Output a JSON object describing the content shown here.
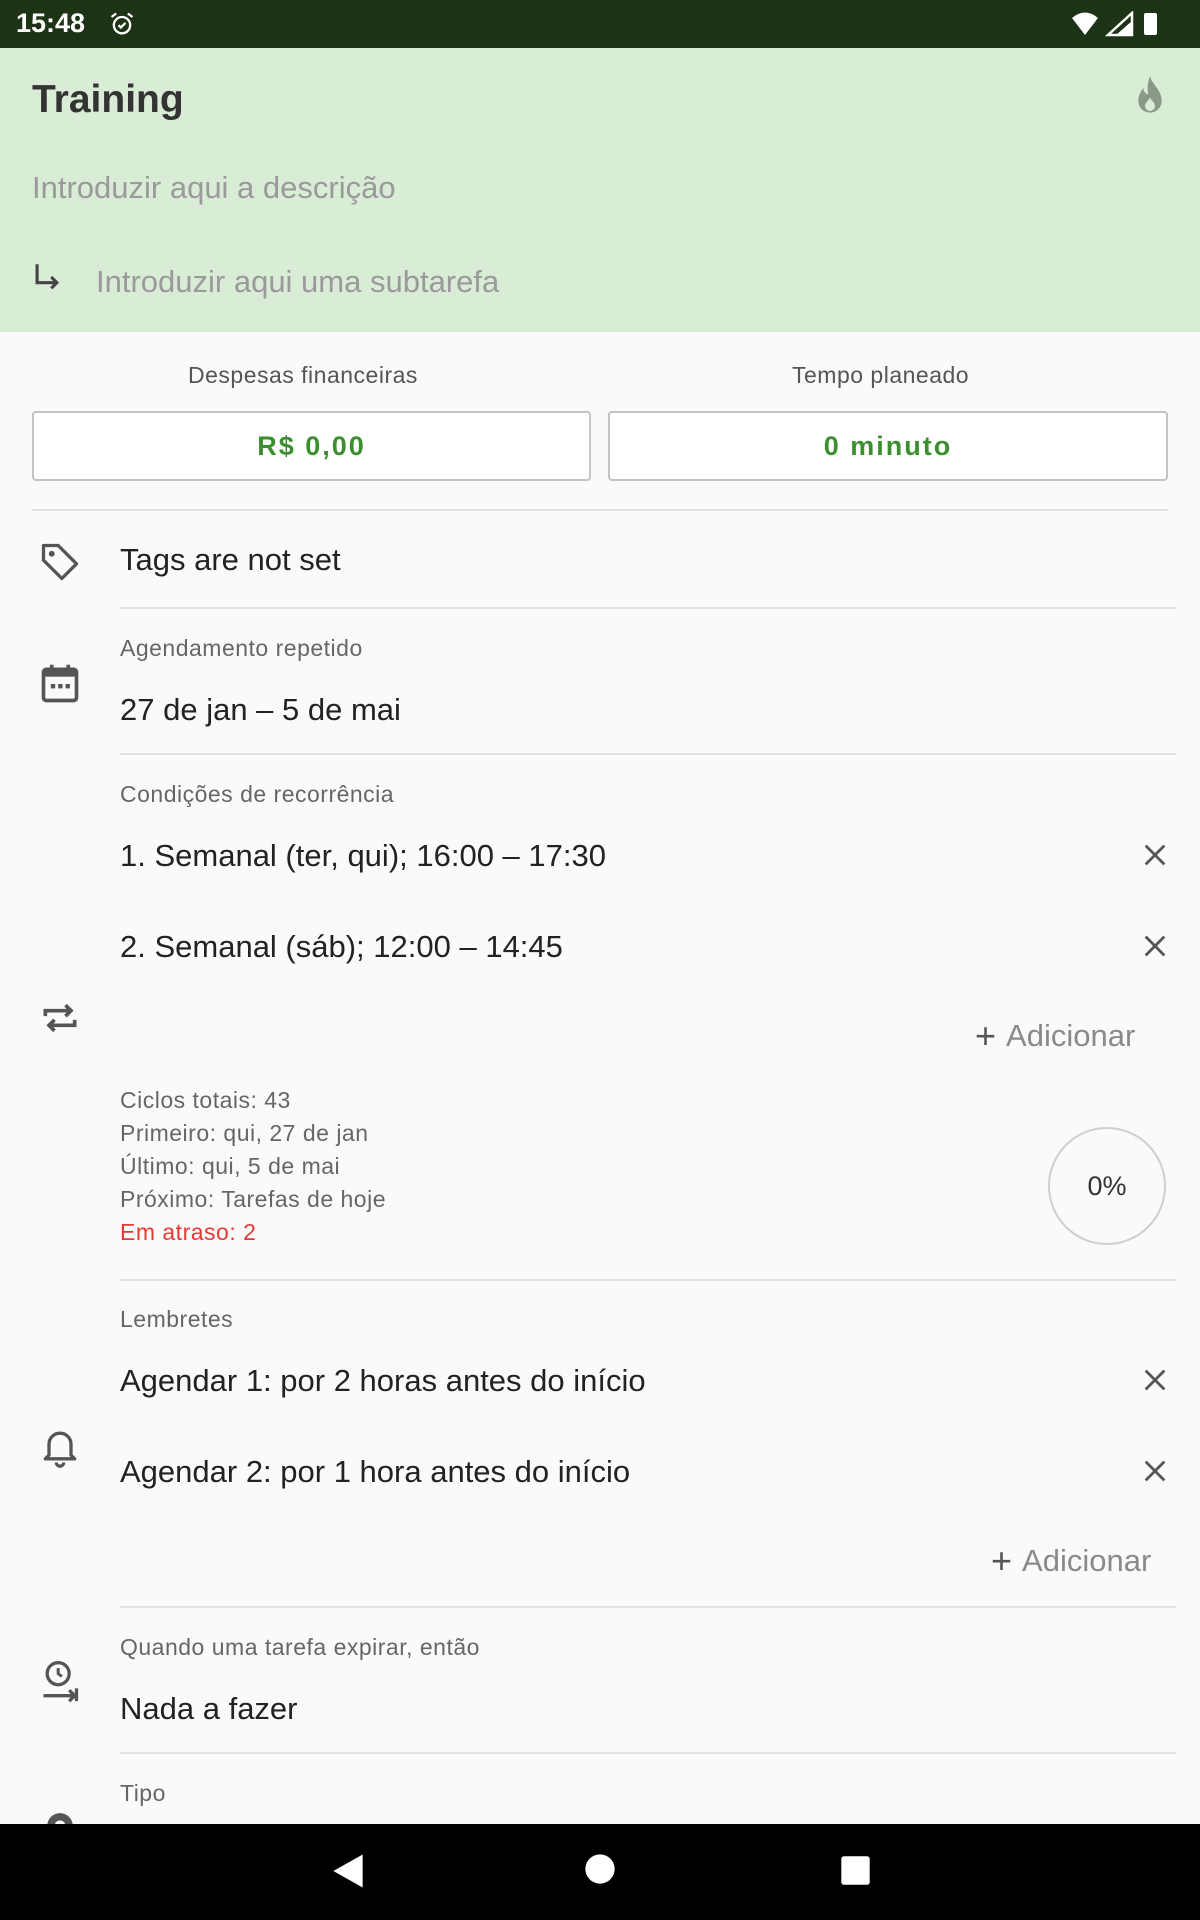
{
  "status_bar": {
    "time": "15:48"
  },
  "task": {
    "title": "Training",
    "description_placeholder": "Introduzir aqui a descrição",
    "subtask_placeholder": "Introduzir aqui uma subtarefa"
  },
  "expenses": {
    "label": "Despesas financeiras",
    "value": "R$ 0,00"
  },
  "planned_time": {
    "label": "Tempo planeado",
    "value": "0 minuto"
  },
  "tags": {
    "text": "Tags are not set"
  },
  "schedule": {
    "label": "Agendamento repetido",
    "value": "27 de jan – 5 de mai"
  },
  "recurrence": {
    "label": "Condições de recorrência",
    "items": [
      "1. Semanal (ter, qui); 16:00 – 17:30",
      "2. Semanal (sáb); 12:00 – 14:45"
    ],
    "add_label": "Adicionar",
    "stats": {
      "total": "Ciclos totais: 43",
      "first": "Primeiro: qui, 27 de jan",
      "last": "Último: qui, 5 de mai",
      "next": "Próximo: Tarefas de hoje",
      "overdue": "Em atraso: 2"
    },
    "progress": "0%",
    "progress_value": 0
  },
  "reminders": {
    "label": "Lembretes",
    "items": [
      "Agendar 1: por 2 horas antes do início",
      "Agendar 2: por 1 hora antes do início"
    ],
    "add_label": "Adicionar"
  },
  "expiry": {
    "label": "Quando uma tarefa expirar, então",
    "value": "Nada a fazer"
  },
  "type": {
    "label": "Tipo"
  },
  "colors": {
    "header_bg": "#d9ecd6",
    "accent_green": "#3c8f2f",
    "overdue_red": "#e53935",
    "status_bar_bg": "#1c3316"
  }
}
